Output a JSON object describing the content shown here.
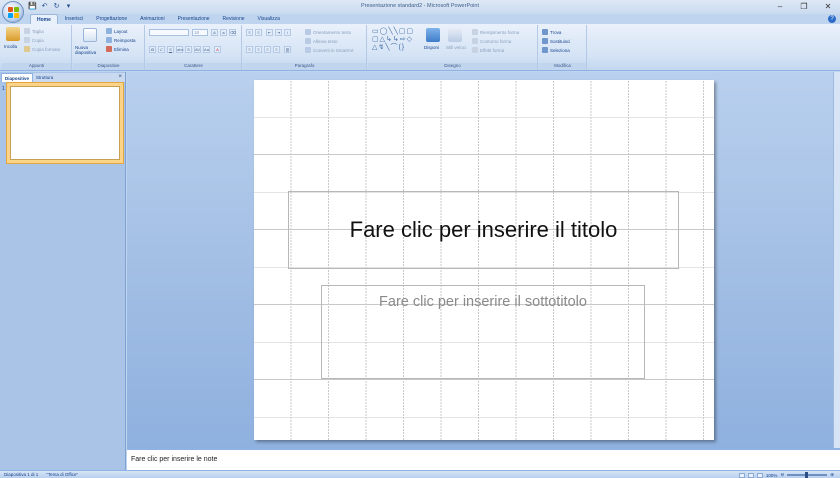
{
  "window": {
    "title": "Presentazione standard2 - Microsoft PowerPoint",
    "controls": [
      "–",
      "❐",
      "✕"
    ]
  },
  "qat": {
    "save": "💾",
    "undo": "↶",
    "redo": "↻",
    "more": "▾"
  },
  "tabs": [
    "Home",
    "Inserisci",
    "Progettazione",
    "Animazioni",
    "Presentazione",
    "Revisione",
    "Visualizza"
  ],
  "ribbon": {
    "clipboard": {
      "label": "Appunti",
      "paste": "Incolla",
      "cut": "Taglia",
      "copy": "Copia",
      "format_painter": "Copia formato"
    },
    "slides": {
      "label": "Diapositive",
      "new_slide": "Nuova diapositiva",
      "layout": "Layout",
      "reset": "Reimposta",
      "delete": "Elimina"
    },
    "font": {
      "label": "Carattere",
      "font_name": "",
      "font_size": "18"
    },
    "paragraph": {
      "label": "Paragrafo",
      "text_direction": "Orientamento testo",
      "align_text": "Allinea testo",
      "convert_smartart": "Converti in SmartArt"
    },
    "drawing": {
      "label": "Disegno",
      "arrange": "Disponi",
      "quick_styles": "Stili veloci",
      "shape_fill": "Riempimento forma",
      "shape_outline": "Contorno forma",
      "shape_effects": "Effetti forma"
    },
    "editing": {
      "label": "Modifica",
      "find": "Trova",
      "replace": "Sostituisci",
      "select": "Seleziona"
    }
  },
  "left_panel": {
    "tabs": [
      "Diapositive",
      "Struttura"
    ],
    "close": "×",
    "slide_number": "1"
  },
  "slide": {
    "title_placeholder": "Fare clic per inserire il titolo",
    "subtitle_placeholder": "Fare clic per inserire il sottotitolo"
  },
  "notes": {
    "placeholder": "Fare clic per inserire le note"
  },
  "status": {
    "slide_info": "Diapositiva 1 di 1",
    "theme": "\"Tema di Office\"",
    "zoom": "100%"
  }
}
